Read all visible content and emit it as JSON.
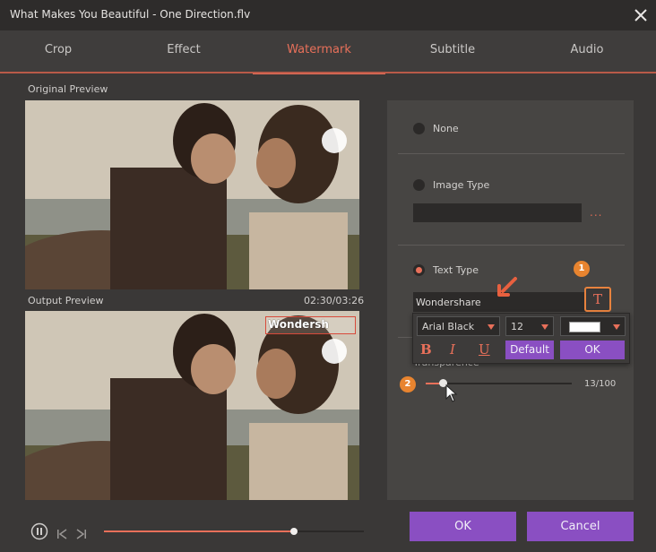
{
  "window": {
    "title": "What Makes You Beautiful - One Direction.flv"
  },
  "tabs": [
    {
      "label": "Crop"
    },
    {
      "label": "Effect"
    },
    {
      "label": "Watermark",
      "active": true
    },
    {
      "label": "Subtitle"
    },
    {
      "label": "Audio"
    }
  ],
  "preview": {
    "original_label": "Original Preview",
    "output_label": "Output Preview",
    "timecode": "02:30/03:26",
    "watermark_overlay_text": "Wondersh"
  },
  "watermark": {
    "options": {
      "none": "None",
      "image": "Image Type",
      "image_more": "...",
      "text": "Text Type"
    },
    "selected": "text",
    "text_value": "Wondershare",
    "font_icon_glyph": "T",
    "font_popup": {
      "font": "Arial Black",
      "size": "12",
      "color": "#ffffff",
      "bold_glyph": "B",
      "italic_glyph": "I",
      "underline_glyph": "U",
      "default_label": "Default",
      "ok_label": "OK"
    },
    "transparency": {
      "label": "Transparence",
      "value_text": "13/100",
      "fraction": 0.13
    },
    "callouts": [
      "1",
      "2"
    ]
  },
  "player": {
    "play_icon": "pause-icon",
    "prev_icon": "previous-frame-icon",
    "next_icon": "next-frame-icon",
    "progress": 0.73
  },
  "buttons": {
    "ok": "OK",
    "cancel": "Cancel"
  },
  "colors": {
    "accent": "#e8705a",
    "purple": "#8a4fc2",
    "callout": "#e8842f"
  }
}
